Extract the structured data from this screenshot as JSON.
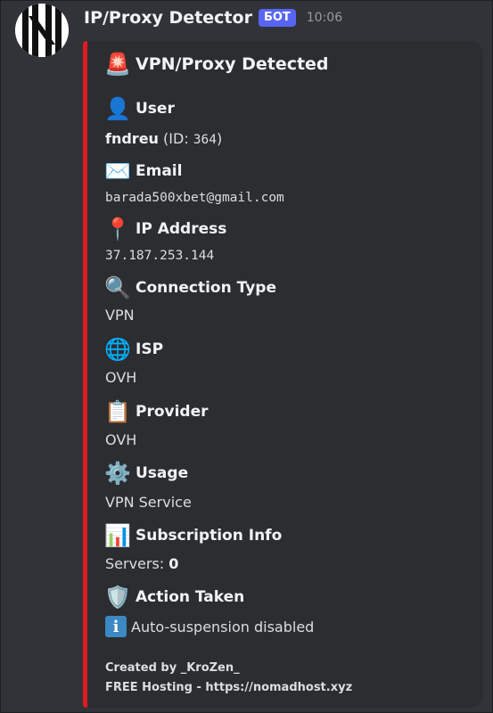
{
  "message": {
    "author": "IP/Proxy Detector",
    "tag": "БОТ",
    "time": "10:06"
  },
  "embed": {
    "accent_color": "#e01b24",
    "title_icon": "🚨",
    "title": "VPN/Proxy Detected",
    "fields": {
      "user": {
        "icon": "👤",
        "name": "User",
        "username": "fndreu",
        "id_prefix": "(ID: ",
        "id": "364",
        "id_suffix": ")"
      },
      "email": {
        "icon": "✉️",
        "name": "Email",
        "value": "barada500xbet@gmail.com"
      },
      "ip": {
        "icon": "📍",
        "name": "IP Address",
        "value": "37.187.253.144"
      },
      "conn": {
        "icon": "🔍",
        "name": "Connection Type",
        "value": "VPN"
      },
      "isp": {
        "icon": "🌐",
        "name": "ISP",
        "value": "OVH"
      },
      "provider": {
        "icon": "📋",
        "name": "Provider",
        "value": "OVH"
      },
      "usage": {
        "icon": "⚙️",
        "name": "Usage",
        "value": "VPN Service"
      },
      "subs": {
        "icon": "📊",
        "name": "Subscription Info",
        "label": "Servers: ",
        "value": "0"
      },
      "action": {
        "icon": "🛡️",
        "name": "Action Taken",
        "info_icon": "i",
        "value": "Auto-suspension disabled"
      }
    },
    "footer": {
      "line1": "Created by _KroZen_",
      "line2": "FREE Hosting - https://nomadhost.xyz"
    }
  }
}
